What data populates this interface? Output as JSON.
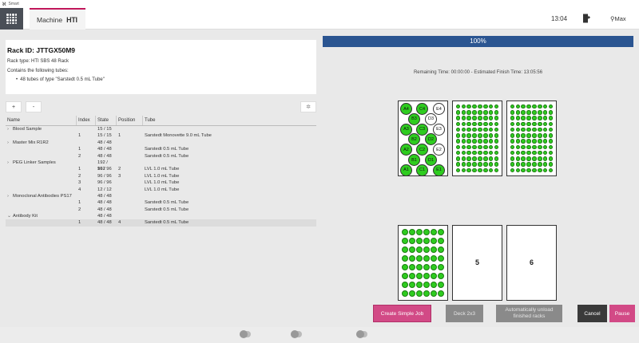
{
  "window": {
    "title": "Smart"
  },
  "header": {
    "tab_label": "Machine",
    "brand": "HTI",
    "time": "13:04",
    "user": "Max"
  },
  "rack_info": {
    "rack_id": "Rack ID: JTTGX50M9",
    "rack_type": "Rack type: HTI SBS 48 Rack",
    "contains": "Contains the following tubes:",
    "tubes": [
      "48 tubes of type \"Sarstedt 0.5 mL Tube\""
    ]
  },
  "toolbar": {
    "expand_label": "+",
    "collapse_label": "-",
    "reset_icon": "settings-icon"
  },
  "tree": {
    "columns": [
      "Name",
      "Index",
      "State",
      "Position",
      "Tube"
    ],
    "rows": [
      {
        "caret": "›",
        "name": "Blood Sample",
        "index": "",
        "state": "15 / 15",
        "position": "",
        "tube": ""
      },
      {
        "caret": "",
        "name": "",
        "index": "1",
        "state": "15 / 15",
        "position": "1",
        "tube": "Sarstedt Monovette 9.0 mL Tube"
      },
      {
        "caret": "›",
        "name": "Master Mix R1R2",
        "index": "",
        "state": "48 / 48",
        "position": "",
        "tube": ""
      },
      {
        "caret": "",
        "name": "",
        "index": "1",
        "state": "48 / 48",
        "position": "",
        "tube": "Sarstedt 0.5 mL Tube"
      },
      {
        "caret": "",
        "name": "",
        "index": "2",
        "state": "48 / 48",
        "position": "",
        "tube": "Sarstedt 0.5 mL Tube"
      },
      {
        "caret": "›",
        "name": "PEG Linker Samples",
        "index": "",
        "state": "192 / 192",
        "position": "",
        "tube": ""
      },
      {
        "caret": "",
        "name": "",
        "index": "1",
        "state": "96 / 96",
        "position": "2",
        "tube": "LVL 1.0 mL Tube"
      },
      {
        "caret": "",
        "name": "",
        "index": "2",
        "state": "96 / 96",
        "position": "3",
        "tube": "LVL 1.0 mL Tube"
      },
      {
        "caret": "",
        "name": "",
        "index": "3",
        "state": "96 / 96",
        "position": "",
        "tube": "LVL 1.0 mL Tube"
      },
      {
        "caret": "",
        "name": "",
        "index": "4",
        "state": "12 / 12",
        "position": "",
        "tube": "LVL 1.0 mL Tube"
      },
      {
        "caret": "›",
        "name": "Monoclonal Antibodies PS17",
        "index": "",
        "state": "48 / 48",
        "position": "",
        "tube": ""
      },
      {
        "caret": "",
        "name": "",
        "index": "1",
        "state": "48 / 48",
        "position": "",
        "tube": "Sarstedt 0.5 mL Tube"
      },
      {
        "caret": "",
        "name": "",
        "index": "2",
        "state": "48 / 48",
        "position": "",
        "tube": "Sarstedt 0.5 mL Tube"
      },
      {
        "caret": "⌄",
        "name": "Antibody Kit",
        "index": "",
        "state": "48 / 48",
        "position": "",
        "tube": ""
      },
      {
        "caret": "",
        "name": "",
        "index": "1",
        "state": "48 / 48",
        "position": "4",
        "tube": "Sarstedt 0.5 mL Tube"
      }
    ]
  },
  "run": {
    "progress_label": "100%",
    "progress_fraction": 1.0,
    "remaining": "Remaining Time: 00:00:00 - Estimated Finish Time: 13:05:56"
  },
  "deck": {
    "rack1_tubes": [
      {
        "label": "A4",
        "filled": true
      },
      {
        "label": "C4",
        "filled": true
      },
      {
        "label": "E4",
        "filled": false
      },
      {
        "label": "B3",
        "filled": true
      },
      {
        "label": "D3",
        "filled": false
      },
      {
        "label": "A3",
        "filled": true
      },
      {
        "label": "C3",
        "filled": true
      },
      {
        "label": "E3",
        "filled": false
      },
      {
        "label": "B2",
        "filled": true
      },
      {
        "label": "D2",
        "filled": true
      },
      {
        "label": "A2",
        "filled": true
      },
      {
        "label": "C2",
        "filled": true
      },
      {
        "label": "E2",
        "filled": false
      },
      {
        "label": "B1",
        "filled": true
      },
      {
        "label": "D1",
        "filled": true
      },
      {
        "label": "A1",
        "filled": true
      },
      {
        "label": "C1",
        "filled": true
      },
      {
        "label": "E1",
        "filled": true
      }
    ],
    "slot5_label": "5",
    "slot6_label": "6",
    "tube_color": "#2ecc1f"
  },
  "buttons": {
    "create_simple_job": "Create Simple Job",
    "deck": "Deck 2x3",
    "auto_unload_line1": "Automatically unload",
    "auto_unload_line2": "finished racks",
    "cancel": "Cancel",
    "pause": "Pause"
  },
  "colors": {
    "accent": "#d24a86",
    "progress": "#2b5591",
    "header_dark": "#4a4f57"
  }
}
